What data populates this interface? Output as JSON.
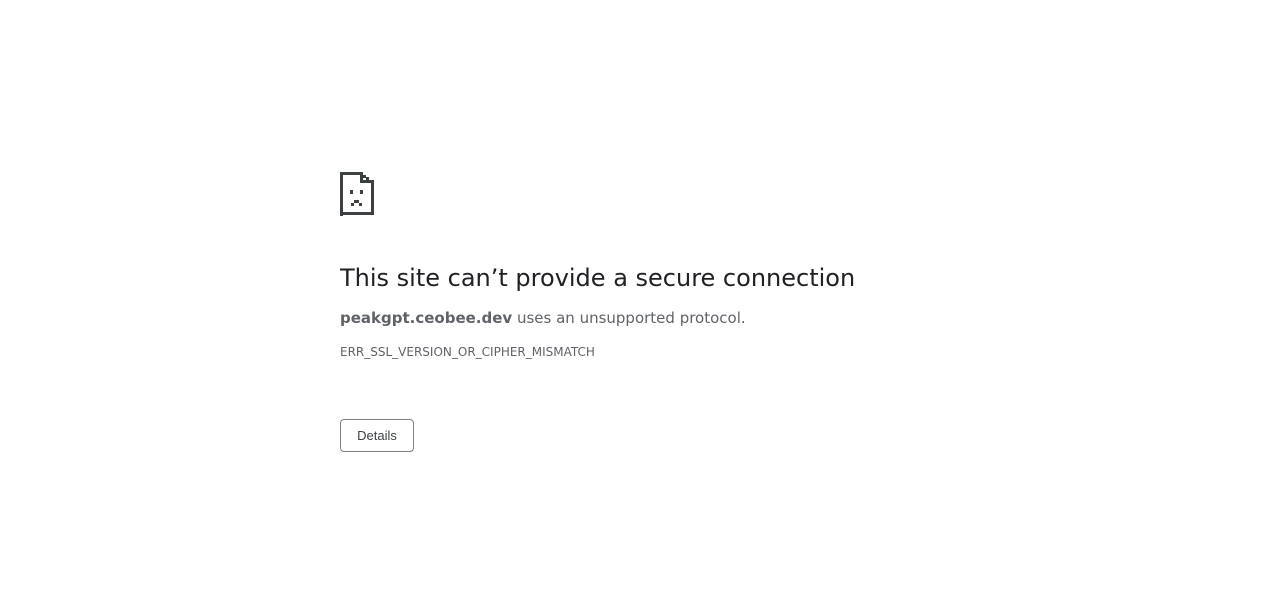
{
  "page": {
    "title": "This site can’t provide a secure connection",
    "host": "peakgpt.ceobee.dev",
    "summary_rest": " uses an unsupported protocol.",
    "error_code": "ERR_SSL_VERSION_OR_CIPHER_MISMATCH",
    "details_label": "Details",
    "icon": "sad-document-icon"
  },
  "colors": {
    "title": "#202124",
    "body_text": "#5f6368",
    "button_border": "#7f7f7f",
    "icon": "#3c4043"
  }
}
